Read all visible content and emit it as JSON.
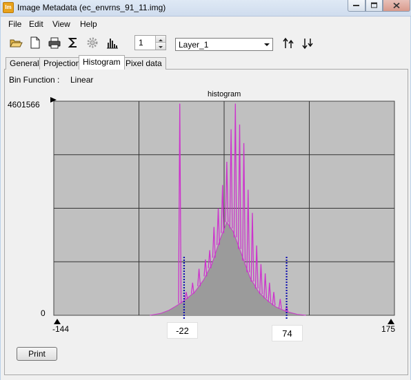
{
  "window": {
    "title": "Image Metadata (ec_envrns_91_11.img)",
    "app_icon_text": "Im"
  },
  "menu": [
    "File",
    "Edit",
    "View",
    "Help"
  ],
  "toolbar": {
    "icons": [
      "open-folder-icon",
      "new-document-icon",
      "print-icon",
      "sigma-icon",
      "settings-gear-icon",
      "histogram-icon"
    ],
    "layer_number": "1",
    "layer_select": "Layer_1",
    "sort_up_icon": "sort-ascending-icon",
    "sort_down_icon": "sort-descending-icon"
  },
  "tabs": [
    {
      "label": "General",
      "active": false
    },
    {
      "label": "Projection",
      "active": false
    },
    {
      "label": "Histogram",
      "active": true
    },
    {
      "label": "Pixel data",
      "active": false
    }
  ],
  "histogram": {
    "bin_function_label": "Bin Function :",
    "bin_function_value": "Linear",
    "chart_title": "histogram",
    "y_max_label": "4601566",
    "y_min_label": "0",
    "x_min_label": "-144",
    "x_max_label": "175",
    "lower_cutoff_label": "-22",
    "upper_cutoff_label": "74"
  },
  "chart_data": {
    "type": "area",
    "title": "histogram",
    "x_range": [
      -144,
      175
    ],
    "y_range": [
      0,
      4601566
    ],
    "grid": true,
    "line_color": "#cc33cc",
    "fill_color": "#9b9b9b",
    "plot_background": "#c0c0c0",
    "cutoff_color": "#1010b0",
    "cutoffs": [
      -22,
      74
    ],
    "spikes": [
      {
        "x": -26,
        "y": 4550000
      },
      {
        "x": -20,
        "y": 500000
      },
      {
        "x": -14,
        "y": 700000
      },
      {
        "x": -8,
        "y": 1000000
      },
      {
        "x": -2,
        "y": 1200000
      },
      {
        "x": 2,
        "y": 1400000
      },
      {
        "x": 6,
        "y": 1900000
      },
      {
        "x": 10,
        "y": 2300000
      },
      {
        "x": 14,
        "y": 2800000
      },
      {
        "x": 18,
        "y": 3300000
      },
      {
        "x": 22,
        "y": 4000000
      },
      {
        "x": 26,
        "y": 4550000
      },
      {
        "x": 30,
        "y": 4100000
      },
      {
        "x": 34,
        "y": 3700000
      },
      {
        "x": 38,
        "y": 2700000
      },
      {
        "x": 42,
        "y": 2200000
      },
      {
        "x": 46,
        "y": 1500000
      },
      {
        "x": 50,
        "y": 1100000
      },
      {
        "x": 54,
        "y": 900000
      },
      {
        "x": 58,
        "y": 700000
      },
      {
        "x": 62,
        "y": 500000
      },
      {
        "x": 68,
        "y": 350000
      },
      {
        "x": 74,
        "y": 200000
      }
    ],
    "envelope": [
      {
        "x": -54,
        "y": 0
      },
      {
        "x": -44,
        "y": 40000
      },
      {
        "x": -36,
        "y": 110000
      },
      {
        "x": -28,
        "y": 220000
      },
      {
        "x": -20,
        "y": 350000
      },
      {
        "x": -12,
        "y": 500000
      },
      {
        "x": -4,
        "y": 750000
      },
      {
        "x": 4,
        "y": 1100000
      },
      {
        "x": 12,
        "y": 1650000
      },
      {
        "x": 18,
        "y": 2000000
      },
      {
        "x": 24,
        "y": 1800000
      },
      {
        "x": 32,
        "y": 1300000
      },
      {
        "x": 40,
        "y": 800000
      },
      {
        "x": 48,
        "y": 500000
      },
      {
        "x": 56,
        "y": 320000
      },
      {
        "x": 64,
        "y": 180000
      },
      {
        "x": 74,
        "y": 80000
      },
      {
        "x": 84,
        "y": 20000
      },
      {
        "x": 92,
        "y": 0
      }
    ]
  }
}
